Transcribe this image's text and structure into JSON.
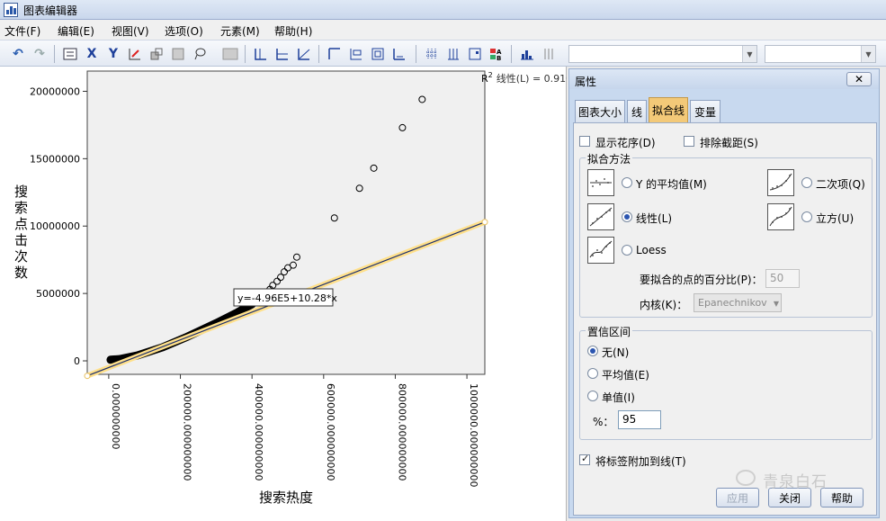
{
  "window": {
    "title": "图表编辑器"
  },
  "menu": [
    {
      "label": "文件(F)"
    },
    {
      "label": "编辑(E)"
    },
    {
      "label": "视图(V)"
    },
    {
      "label": "选项(O)"
    },
    {
      "label": "元素(M)"
    },
    {
      "label": "帮助(H)"
    }
  ],
  "toolbar": {
    "x_label": "X",
    "y_label": "Y"
  },
  "chart_data": {
    "type": "scatter",
    "xlabel": "搜索热度",
    "ylabel": "搜索点击次数",
    "x_tick_labels": [
      "0.000000000",
      "200000.000000000",
      "400000.000000000",
      "600000.000000000",
      "800000.000000000",
      "1000000.000000000"
    ],
    "y_tick_labels": [
      "0",
      "5000000",
      "10000000",
      "15000000",
      "20000000"
    ],
    "xlim": [
      -60000,
      1050000
    ],
    "ylim": [
      -1000000,
      21500000
    ],
    "fit_equation": "y=-4.96E5+10.28*x",
    "r2_label": "R",
    "r2_sup": "2",
    "r2_text": "线性(L) = 0.910",
    "fit_line": {
      "intercept": -496000,
      "slope": 10.28
    },
    "dense_band": [
      [
        5000,
        80000
      ],
      [
        30000,
        130000
      ],
      [
        80000,
        400000
      ],
      [
        150000,
        1000000
      ],
      [
        220000,
        1800000
      ],
      [
        300000,
        2800000
      ],
      [
        360000,
        3600000
      ],
      [
        400000,
        4200000
      ]
    ],
    "points": [
      {
        "x": 430000,
        "y": 4700000
      },
      {
        "x": 440000,
        "y": 5000000
      },
      {
        "x": 450000,
        "y": 5300000
      },
      {
        "x": 458000,
        "y": 5600000
      },
      {
        "x": 470000,
        "y": 5900000
      },
      {
        "x": 480000,
        "y": 6200000
      },
      {
        "x": 490000,
        "y": 6600000
      },
      {
        "x": 500000,
        "y": 6900000
      },
      {
        "x": 515000,
        "y": 7100000
      },
      {
        "x": 525000,
        "y": 7700000
      },
      {
        "x": 630000,
        "y": 10600000
      },
      {
        "x": 700000,
        "y": 12800000
      },
      {
        "x": 740000,
        "y": 14300000
      },
      {
        "x": 820000,
        "y": 17300000
      },
      {
        "x": 875000,
        "y": 19400000
      }
    ],
    "fit_line_color": "#1b2e6e",
    "highlight_color": "#ffe08a",
    "plot_bg": "#f0f0f0"
  },
  "panel": {
    "title": "属性",
    "close": "✕",
    "tabs": [
      {
        "label": "图表大小"
      },
      {
        "label": "线"
      },
      {
        "label": "拟合线"
      },
      {
        "label": "变量"
      }
    ],
    "active_tab": "拟合线",
    "show_pattern": "显示花序(D)",
    "exclude_intercept": "排除截距(S)",
    "fit_method_title": "拟合方法",
    "methods": [
      {
        "label": "Y 的平均值(M)"
      },
      {
        "label": "二次项(Q)"
      },
      {
        "label": "线性(L)"
      },
      {
        "label": "立方(U)"
      },
      {
        "label": "Loess"
      }
    ],
    "loess_percent_label": "要拟合的点的百分比(P)：",
    "loess_percent_value": "50",
    "kernel_label": "内核(K)：",
    "kernel_value": "Epanechnikov",
    "ci_title": "置信区间",
    "ci_options": [
      {
        "label": "无(N)"
      },
      {
        "label": "平均值(E)"
      },
      {
        "label": "单值(I)"
      }
    ],
    "percent_label": "%：",
    "percent_value": "95",
    "attach_label": "将标签附加到线(T)",
    "buttons": {
      "apply": "应用",
      "close": "关闭",
      "help": "帮助"
    }
  },
  "watermark": "青泉白石"
}
